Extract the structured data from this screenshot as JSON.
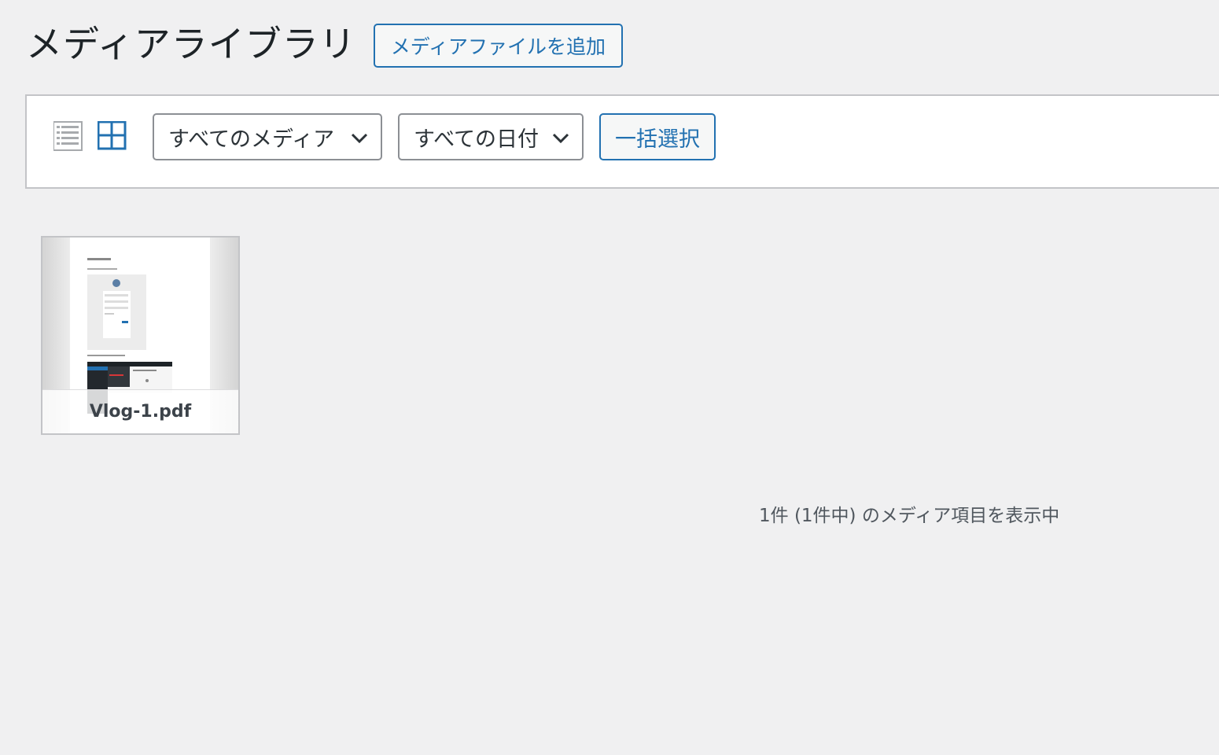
{
  "header": {
    "title": "メディアライブラリ",
    "add_button_label": "メディアファイルを追加"
  },
  "toolbar": {
    "list_view_icon": "list-view-icon",
    "grid_view_icon": "grid-view-icon",
    "active_view": "grid",
    "media_filter": {
      "selected": "すべてのメディア"
    },
    "date_filter": {
      "selected": "すべての日付"
    },
    "bulk_select_label": "一括選択"
  },
  "attachments": [
    {
      "filename": "Vlog-1.pdf",
      "type": "pdf"
    }
  ],
  "footer": {
    "count_text": "1件 (1件中) のメディア項目を表示中"
  },
  "colors": {
    "accent": "#2271b1",
    "background": "#f0f0f1",
    "inactive_icon": "#a7aaad"
  }
}
